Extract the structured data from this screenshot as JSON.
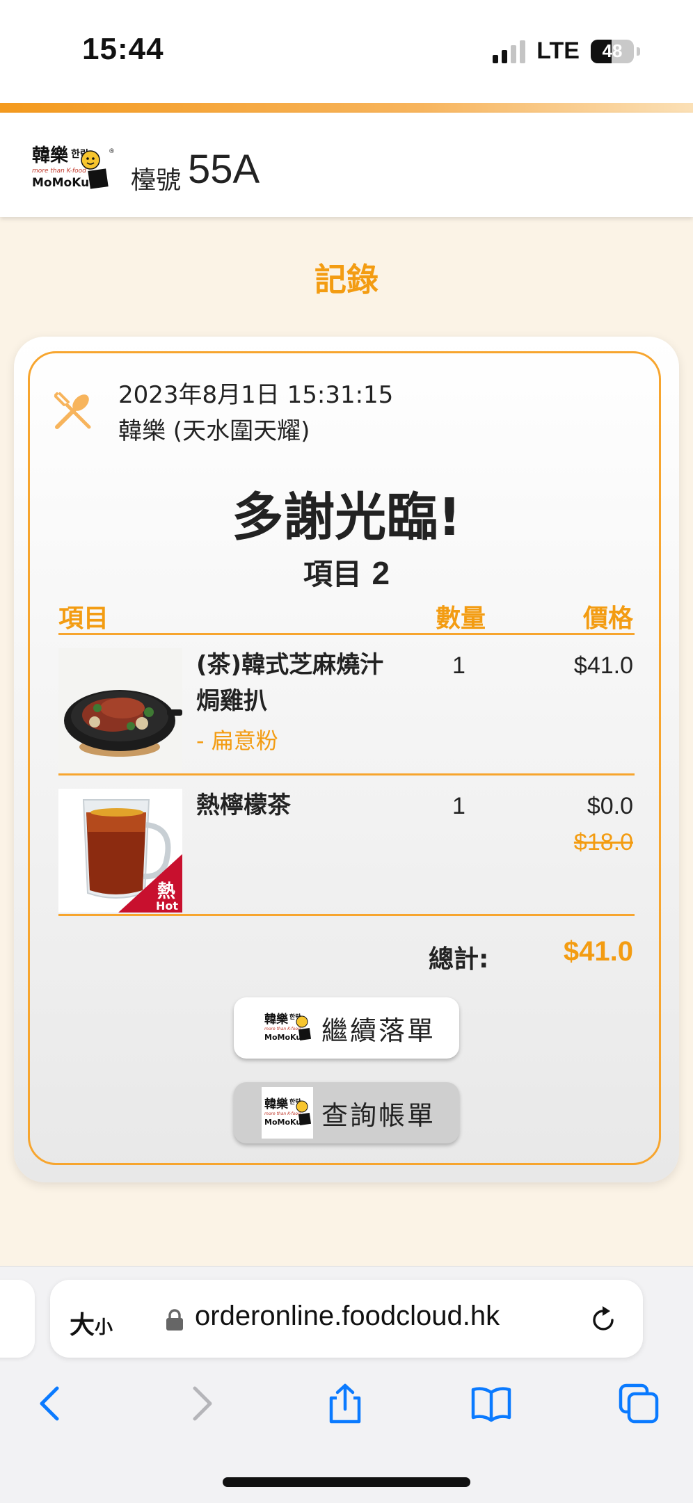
{
  "status_bar": {
    "time": "15:44",
    "network": "LTE",
    "battery": "48",
    "battery_fraction": 0.48
  },
  "header": {
    "brand_logo": "韓樂 MoMoKu logo",
    "table_label": "檯號",
    "table_number": "55A"
  },
  "page_title": "記錄",
  "order": {
    "datetime": "2023年8月1日 15:31:15",
    "store": "韓樂 (天水圍天耀)",
    "thanks": "多謝光臨!",
    "item_count_label": "項目",
    "item_count": "2",
    "columns": {
      "item": "項目",
      "qty": "數量",
      "price": "價格"
    },
    "items": [
      {
        "name": "(茶)韓式芝麻燒汁焗雞扒",
        "option": "- 扁意粉",
        "qty": "1",
        "price": "$41.0",
        "image": "chicken-skillet-photo"
      },
      {
        "name": "熱檸檬茶",
        "qty": "1",
        "price": "$0.0",
        "original_price": "$18.0",
        "image": "hot-lemon-tea-photo",
        "badge_cn": "熱",
        "badge_en": "Hot"
      }
    ],
    "total_label": "總計:",
    "total_value": "$41.0"
  },
  "actions": {
    "continue_order": "繼續落單",
    "view_bill": "查詢帳單"
  },
  "browser": {
    "text_size_big": "大",
    "text_size_small": "小",
    "url": "orderonline.foodcloud.hk"
  },
  "colors": {
    "accent": "#f39c12",
    "border": "#f7a52e",
    "page_bg": "#fbf3e6",
    "ios_blue": "#0a7aff"
  }
}
